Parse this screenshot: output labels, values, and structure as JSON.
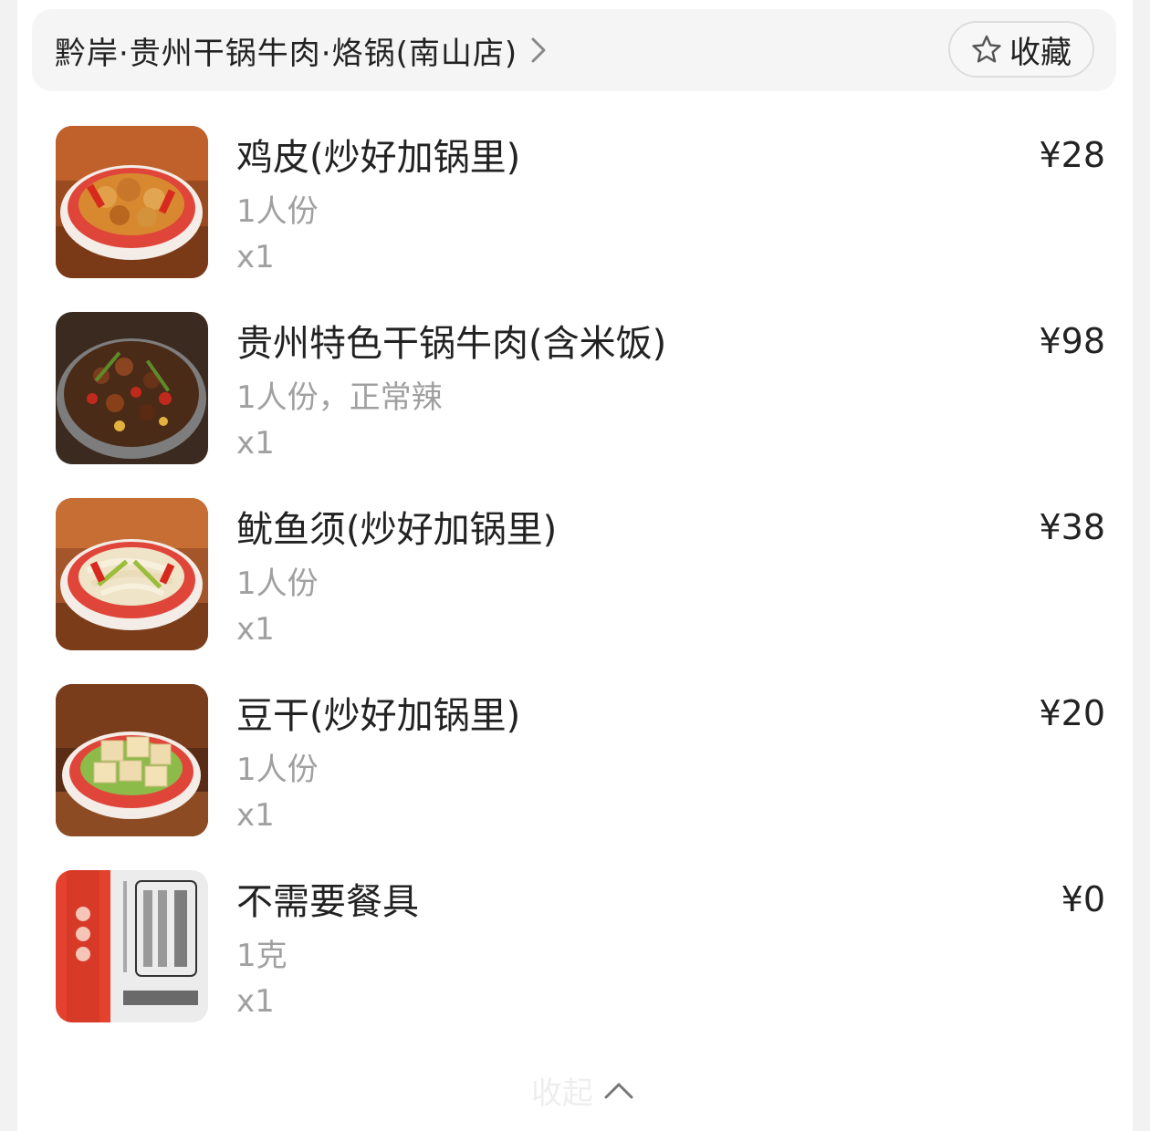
{
  "store": {
    "name": "黔岸·贵州干锅牛肉·烙锅(南山店)",
    "favorite_label": "收藏"
  },
  "items": [
    {
      "name": "鸡皮(炒好加锅里)",
      "spec": "1人份",
      "qty": "x1",
      "price": "¥28",
      "image": "dish-chicken-skin"
    },
    {
      "name": "贵州特色干锅牛肉(含米饭)",
      "spec": "1人份，正常辣",
      "qty": "x1",
      "price": "¥98",
      "image": "dish-dry-pot-beef"
    },
    {
      "name": "鱿鱼须(炒好加锅里)",
      "spec": "1人份",
      "qty": "x1",
      "price": "¥38",
      "image": "dish-squid-tentacles"
    },
    {
      "name": "豆干(炒好加锅里)",
      "spec": "1人份",
      "qty": "x1",
      "price": "¥20",
      "image": "dish-dried-tofu"
    },
    {
      "name": "不需要餐具",
      "spec": "1克",
      "qty": "x1",
      "price": "¥0",
      "image": "no-tableware-pack"
    }
  ],
  "collapse": {
    "label": "收起",
    "icon": "chevron-up-icon"
  },
  "colors": {
    "text": "#222222",
    "muted": "#a0a0a0",
    "header_bg": "#f5f5f5"
  }
}
